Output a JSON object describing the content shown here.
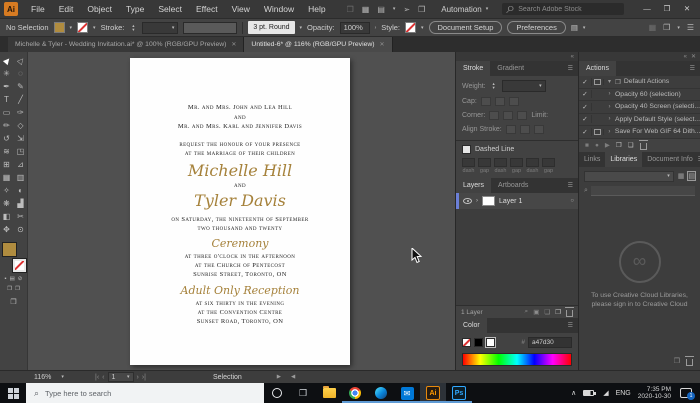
{
  "colors": {
    "gold": "#b08c3f",
    "script_gold": "#a5813a",
    "taskbar_accent": "#5f9bd5"
  },
  "icons": {
    "dropdown": "▾",
    "dropdown_up": "▴",
    "chev_left": "‹",
    "chev_right": "›",
    "bar_left": "|‹",
    "bar_right": "›|",
    "collapse": "«",
    "menu": "☰",
    "close": "✕",
    "minimize": "—",
    "restore": "❒",
    "search": "⌕",
    "check": "✓",
    "play": "▶",
    "stop": "■",
    "record": "●",
    "folder": "❐",
    "new_item": "❏",
    "target": "○",
    "up": "∧",
    "network": "◢",
    "infinity": "∞",
    "envelope": "✉",
    "grid": "▦",
    "list": "▤",
    "pane": "❒",
    "share": "➢",
    "back_arrow": "◀",
    "fwd_arrow": "▶",
    "locate": "⌕",
    "clip": "▣",
    "slash": "⊘",
    "dot": "▪",
    "shade": "▤"
  },
  "menubar": {
    "logo": "Ai",
    "items": [
      "File",
      "Edit",
      "Object",
      "Type",
      "Select",
      "Effect",
      "View",
      "Window",
      "Help"
    ],
    "workspace": "Automation",
    "search_placeholder": "Search Adobe Stock"
  },
  "controlbar": {
    "selection_status": "No Selection",
    "stroke_label": "Stroke:",
    "brush_name": "3 pt. Round",
    "opacity_label": "Opacity:",
    "opacity_value": "100%",
    "style_label": "Style:",
    "document_setup": "Document Setup",
    "preferences": "Preferences"
  },
  "tabs": {
    "tab1": "Michelle & Tyler - Wedding Invitation.ai* @ 100% (RGB/GPU Preview)",
    "tab2": "Untitled-6* @ 116% (RGB/GPU Preview)"
  },
  "toolbar": {
    "tools": [
      {
        "name": "selection-tool",
        "glyph": "▶"
      },
      {
        "name": "direct-selection-tool",
        "glyph": "▷"
      },
      {
        "name": "magic-wand-tool",
        "glyph": "✳"
      },
      {
        "name": "lasso-tool",
        "glyph": "◌"
      },
      {
        "name": "pen-tool",
        "glyph": "✒"
      },
      {
        "name": "curvature-tool",
        "glyph": "✎"
      },
      {
        "name": "type-tool",
        "glyph": "T"
      },
      {
        "name": "line-segment-tool",
        "glyph": "╱"
      },
      {
        "name": "rectangle-tool",
        "glyph": "▭"
      },
      {
        "name": "paintbrush-tool",
        "glyph": "✑"
      },
      {
        "name": "pencil-tool",
        "glyph": "✏"
      },
      {
        "name": "eraser-tool",
        "glyph": "◇"
      },
      {
        "name": "rotate-tool",
        "glyph": "↺"
      },
      {
        "name": "scale-tool",
        "glyph": "⇲"
      },
      {
        "name": "width-tool",
        "glyph": "≋"
      },
      {
        "name": "free-transform-tool",
        "glyph": "◳"
      },
      {
        "name": "shape-builder-tool",
        "glyph": "⊞"
      },
      {
        "name": "perspective-grid-tool",
        "glyph": "⊿"
      },
      {
        "name": "mesh-tool",
        "glyph": "▦"
      },
      {
        "name": "gradient-tool",
        "glyph": "▥"
      },
      {
        "name": "eyedropper-tool",
        "glyph": "✧"
      },
      {
        "name": "blend-tool",
        "glyph": "◐"
      },
      {
        "name": "symbol-sprayer-tool",
        "glyph": "❋"
      },
      {
        "name": "column-graph-tool",
        "glyph": "▟"
      },
      {
        "name": "artboard-tool",
        "glyph": "◧"
      },
      {
        "name": "slice-tool",
        "glyph": "✂"
      },
      {
        "name": "hand-tool",
        "glyph": "✥"
      },
      {
        "name": "zoom-tool",
        "glyph": "⊙"
      }
    ]
  },
  "invitation": {
    "parents1": "Mr. and Mrs. John and Lea Hill",
    "and1": "and",
    "parents2": "Mr. and Mrs. Karl and Jennifer Davis",
    "request1": "request the honour of your presence",
    "request2": "at the marriage of their children",
    "bride": "Michelle Hill",
    "and2": "and",
    "groom": "Tyler Davis",
    "date1": "on Saturday, the nineteenth of September",
    "date2": "two thousand and twenty",
    "ceremony_title": "Ceremony",
    "ceremony_line1": "at three o'clock in the afternoon",
    "ceremony_line2": "at the Church of Pentecost",
    "ceremony_line3": "Sunrise Street, Toronto, ON",
    "reception_title": "Adult Only Reception",
    "reception_line1": "at six thirty in the evening",
    "reception_line2": "at the Convention Centre",
    "reception_line3": "Sunset Road, Toronto, ON"
  },
  "panels": {
    "stroke": {
      "tab_stroke": "Stroke",
      "tab_gradient": "Gradient",
      "weight_label": "Weight:",
      "cap_label": "Cap:",
      "corner_label": "Corner:",
      "limit_label": "Limit:",
      "align_label": "Align Stroke:",
      "dashed_label": "Dashed Line",
      "dash_labels": [
        "dash",
        "gap",
        "dash",
        "gap",
        "dash",
        "gap"
      ]
    },
    "layers": {
      "tab_layers": "Layers",
      "tab_artboards": "Artboards",
      "layer1_name": "Layer 1",
      "count": "1 Layer"
    },
    "color": {
      "tab": "Color",
      "hex_label": "#",
      "hex_value": "a47d30"
    },
    "actions": {
      "tab": "Actions",
      "rows": [
        "Default Actions",
        "Opacity 60 (selection)",
        "Opacity 40 Screen (selecti...",
        "Apply Default Style (select...",
        "Save For Web GIF 64 Dith..."
      ]
    },
    "libraries": {
      "tab_links": "Links",
      "tab_libraries": "Libraries",
      "tab_docinfo": "Document Info",
      "signin_line1": "To use Creative Cloud Libraries,",
      "signin_line2": "please sign in to Creative Cloud"
    }
  },
  "statusbar": {
    "zoom": "116%",
    "artboard_num": "1",
    "status": "Selection"
  },
  "taskbar": {
    "search_placeholder": "Type here to search",
    "ai_label": "Ai",
    "ps_label": "Ps",
    "lang": "ENG",
    "time": "7:35 PM",
    "date": "2020-10-30",
    "badge": "1"
  }
}
